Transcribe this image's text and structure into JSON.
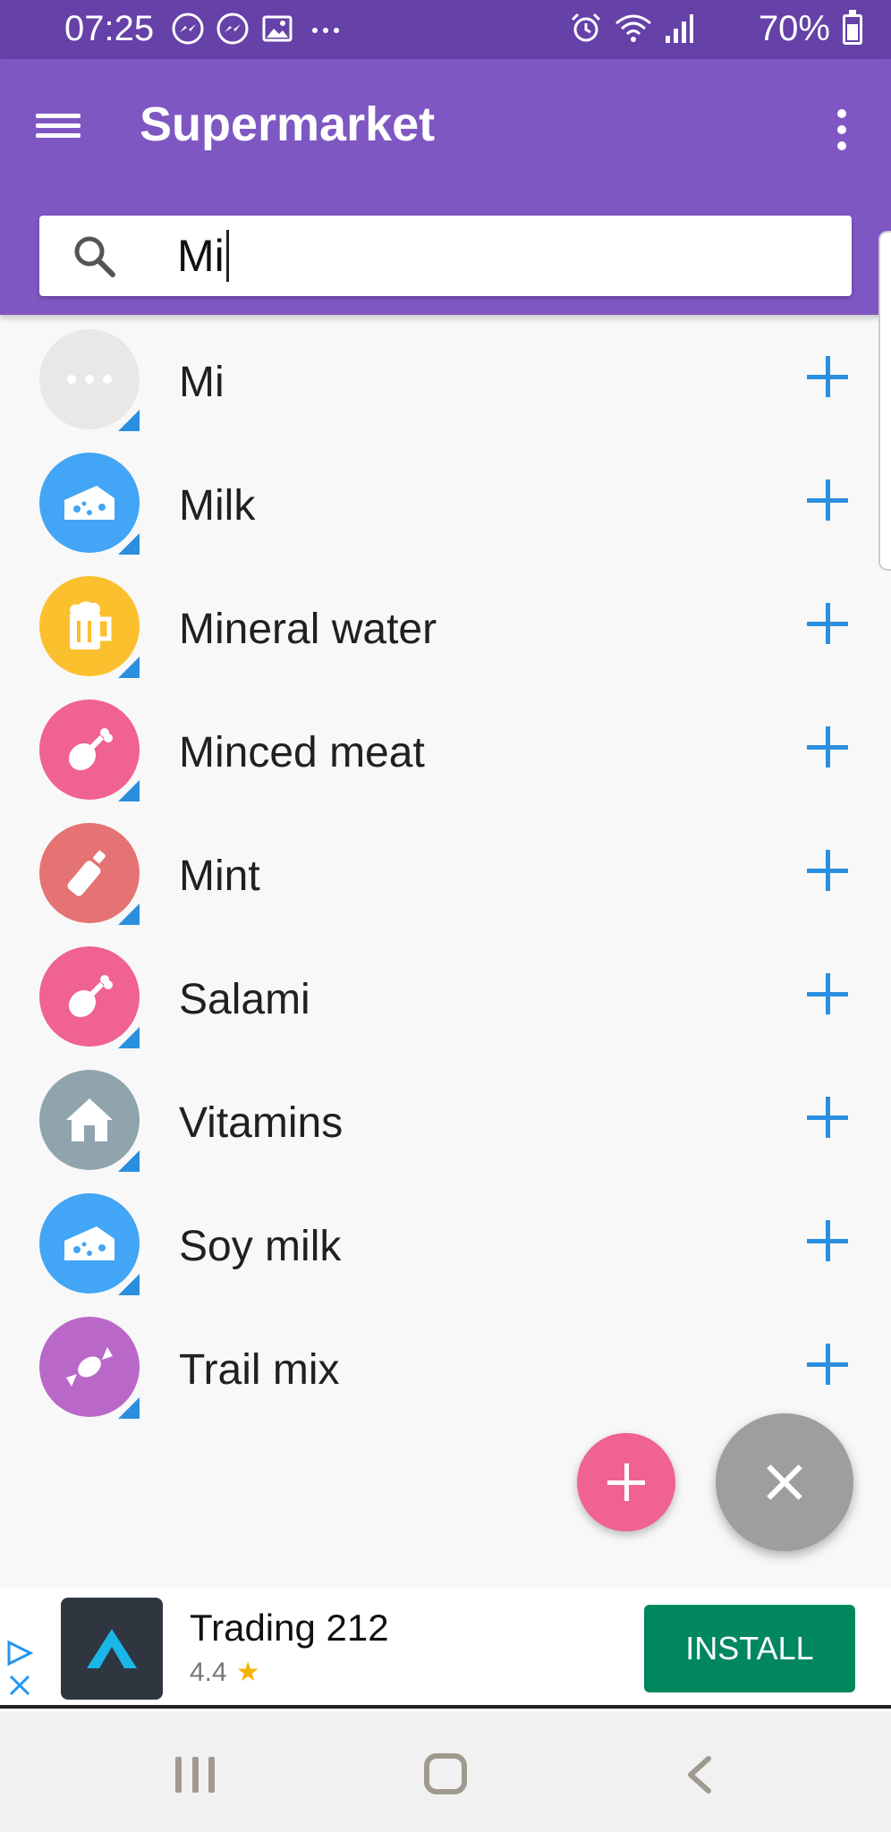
{
  "status_bar": {
    "time": "07:25",
    "battery": "70%",
    "battery_level": 0.7,
    "icons_left": [
      "messenger-icon",
      "messenger-icon",
      "gallery-icon",
      "more-icon"
    ],
    "icons_right": [
      "alarm-icon",
      "wifi-icon",
      "signal-icon",
      "battery-icon"
    ]
  },
  "app_bar": {
    "title": "Supermarket",
    "menu_icon": "hamburger-menu-icon",
    "overflow_icon": "more-vertical-icon"
  },
  "search": {
    "value": "Mi",
    "icon": "search-icon"
  },
  "items": [
    {
      "label": "Mi",
      "icon": "dots-icon",
      "color": "#e8e8e8"
    },
    {
      "label": "Milk",
      "icon": "cheese-icon",
      "color": "#42a5f5"
    },
    {
      "label": "Mineral water",
      "icon": "beer-mug-icon",
      "color": "#fbc02d"
    },
    {
      "label": "Minced meat",
      "icon": "drumstick-icon",
      "color": "#f06292"
    },
    {
      "label": "Mint",
      "icon": "bottle-icon",
      "color": "#e57373"
    },
    {
      "label": "Salami",
      "icon": "drumstick-icon",
      "color": "#f06292"
    },
    {
      "label": "Vitamins",
      "icon": "house-icon",
      "color": "#90a4ae"
    },
    {
      "label": "Soy milk",
      "icon": "cheese-icon",
      "color": "#42a5f5"
    },
    {
      "label": "Trail mix",
      "icon": "candy-icon",
      "color": "#ba68c8"
    }
  ],
  "colors": {
    "status_bar": "#6541a8",
    "app_bar": "#7e57c2",
    "accent_blue": "#2b8fe0",
    "fab_pink": "#f06292",
    "fab_gray": "#9e9e9e",
    "install_green": "#01875f"
  },
  "ad": {
    "title": "Trading 212",
    "rating": "4.4",
    "install_label": "INSTALL"
  },
  "nav": {
    "recent_icon": "recent-apps-icon",
    "home_icon": "home-icon",
    "back_icon": "back-icon"
  }
}
